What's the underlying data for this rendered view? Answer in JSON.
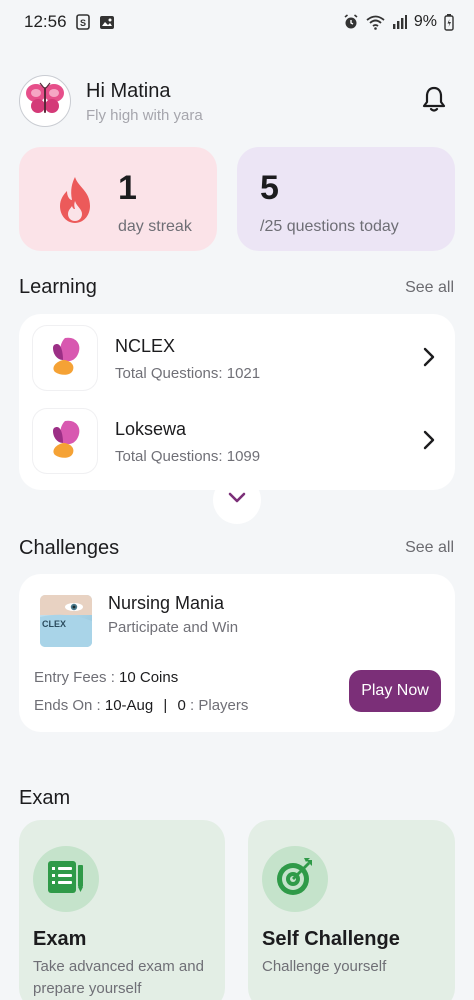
{
  "status_bar": {
    "time": "12:56",
    "battery": "9%",
    "icons": [
      "notification-s-icon",
      "image-icon",
      "alarm-icon",
      "wifi-icon",
      "signal-icon",
      "battery-icon"
    ]
  },
  "header": {
    "greeting": "Hi Matina",
    "subtitle": "Fly high with yara",
    "avatar_icon": "butterfly-icon",
    "notification_icon": "bell-icon"
  },
  "stats": {
    "streak": {
      "value": "1",
      "label": "day streak",
      "icon": "flame-icon",
      "color": "#ec5a5a"
    },
    "questions": {
      "value": "5",
      "label": "/25 questions today"
    }
  },
  "learning": {
    "title": "Learning",
    "see_all": "See all",
    "courses": [
      {
        "title": "NCLEX",
        "subtitle": "Total Questions: 1021"
      },
      {
        "title": "Loksewa",
        "subtitle": "Total Questions: 1099"
      }
    ]
  },
  "challenges": {
    "title": "Challenges",
    "see_all": "See all",
    "item": {
      "title": "Nursing Mania",
      "subtitle": "Participate and Win",
      "entry_label": "Entry Fees :",
      "entry_value": "10 Coins",
      "ends_label": "Ends On :",
      "ends_value": "10-Aug",
      "separator": "|",
      "players_count": "0",
      "players_label": ": Players",
      "thumb_text": "CLEX",
      "button": "Play Now"
    }
  },
  "exam": {
    "title": "Exam",
    "cards": [
      {
        "title": "Exam",
        "description": "Take advanced exam and prepare yourself",
        "icon": "exam-sheet-icon"
      },
      {
        "title": "Self Challenge",
        "description": "Challenge yourself",
        "icon": "target-icon"
      }
    ]
  },
  "colors": {
    "accent": "#7b2f78",
    "streak_bg": "#fbe3e8",
    "questions_bg": "#ece5f5",
    "exam_bg": "#e3eee5",
    "icon_green": "#2f9a48"
  }
}
